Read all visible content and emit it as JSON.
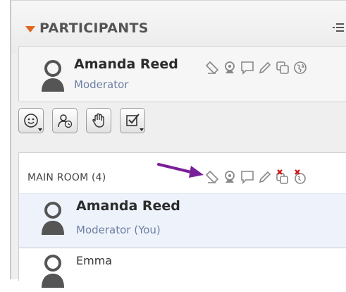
{
  "header": {
    "title": "PARTICIPANTS",
    "menu_icon": "panel-menu-icon"
  },
  "me": {
    "name": "Amanda Reed",
    "role": "Moderator"
  },
  "status_icons": [
    "share-presenter-icon",
    "webcam-icon",
    "chat-icon",
    "pencil-icon",
    "copy-icon",
    "globe-icon"
  ],
  "toolbar": [
    {
      "name": "emoticon-button",
      "icon": "smiley-icon"
    },
    {
      "name": "away-status-button",
      "icon": "person-clock-icon"
    },
    {
      "name": "raise-hand-button",
      "icon": "hand-icon"
    },
    {
      "name": "poll-button",
      "icon": "checkbox-icon"
    }
  ],
  "room": {
    "title": "MAIN ROOM (4)",
    "participants": [
      {
        "name": "Amanda Reed",
        "role": "Moderator (You)"
      },
      {
        "name": "Emma"
      }
    ]
  },
  "colors": {
    "accent": "#e2661d",
    "arrow": "#7a1f9a",
    "role": "#6d7fa3",
    "denied": "#d11a1a"
  }
}
